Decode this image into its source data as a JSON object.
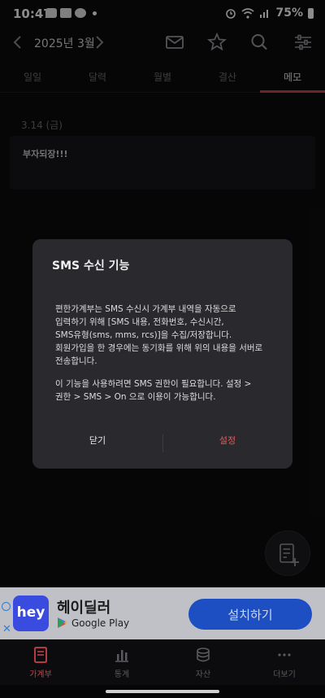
{
  "status_bar": {
    "time": "10:47",
    "battery": "75%"
  },
  "header": {
    "month": "2025년 3월"
  },
  "tabs": [
    "일일",
    "달력",
    "월별",
    "결산",
    "메모"
  ],
  "memo": {
    "date": "3.14 (금)",
    "text": "부자되장!!!"
  },
  "dialog": {
    "title": "SMS 수신 기능",
    "body": "편한가계부는 SMS 수신시 가계부 내역을 자동으로\n입력하기 위해 [SMS 내용, 전화번호, 수신시간,\nSMS유형(sms, mms, rcs)]을 수집/저장합니다.\n회원가입을 한 경우에는 동기화를 위해 위의 내용을 서버로\n전송합니다.",
    "body2": "이 기능을 사용하려면 SMS 권한이 필요합니다. 설정 >\n권한 > SMS > On 으로 이용이 가능합니다.",
    "close_label": "닫기",
    "settings_label": "설정"
  },
  "ad": {
    "logo_text": "hey",
    "title": "헤이딜러",
    "store_label": "Google Play",
    "cta_label": "설치하기"
  },
  "bottom_nav": [
    "가계부",
    "통계",
    "자산",
    "더보기"
  ],
  "colors": {
    "accent": "#c9414a",
    "dialog_bg": "#2a2a2e",
    "ad_cta": "#1e4fc2"
  }
}
